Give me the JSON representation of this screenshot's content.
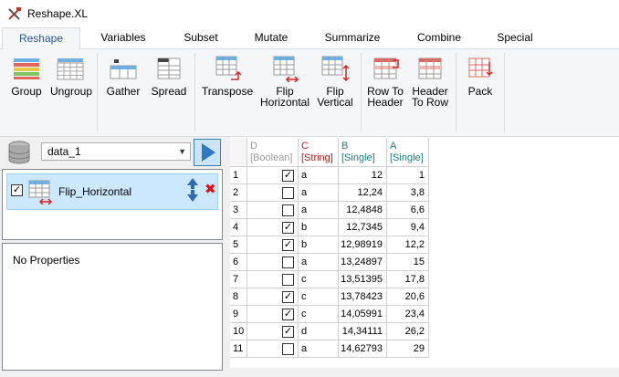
{
  "window": {
    "title": "Reshape.XL"
  },
  "tabs": [
    {
      "label": "Reshape",
      "active": true
    },
    {
      "label": "Variables"
    },
    {
      "label": "Subset"
    },
    {
      "label": "Mutate"
    },
    {
      "label": "Summarize"
    },
    {
      "label": "Combine"
    },
    {
      "label": "Special"
    }
  ],
  "ribbon": {
    "group": {
      "label": "Group"
    },
    "ungroup": {
      "label": "Ungroup"
    },
    "gather": {
      "label": "Gather"
    },
    "spread": {
      "label": "Spread"
    },
    "transpose": {
      "label": "Transpose"
    },
    "flip_h": {
      "line1": "Flip",
      "line2": "Horizontal"
    },
    "flip_v": {
      "line1": "Flip",
      "line2": "Vertical"
    },
    "row_to_header": {
      "line1": "Row To",
      "line2": "Header"
    },
    "header_to_row": {
      "line1": "Header",
      "line2": "To Row"
    },
    "pack": {
      "label": "Pack"
    }
  },
  "dataset": {
    "selected": "data_1"
  },
  "operations": [
    {
      "label": "Flip_Horizontal",
      "checked": true
    }
  ],
  "properties": {
    "text": "No Properties"
  },
  "grid": {
    "columns": [
      {
        "name": "D",
        "type": "[Boolean]",
        "kind": "bool"
      },
      {
        "name": "C",
        "type": "[String]",
        "kind": "str"
      },
      {
        "name": "B",
        "type": "[Single]",
        "kind": "num"
      },
      {
        "name": "A",
        "type": "[Single]",
        "kind": "num"
      }
    ],
    "rows": [
      {
        "n": "1",
        "d": true,
        "c": "a",
        "b": "12",
        "a": "1"
      },
      {
        "n": "2",
        "d": false,
        "c": "a",
        "b": "12,24",
        "a": "3,8"
      },
      {
        "n": "3",
        "d": false,
        "c": "a",
        "b": "12,4848",
        "a": "6,6"
      },
      {
        "n": "4",
        "d": true,
        "c": "b",
        "b": "12,7345",
        "a": "9,4"
      },
      {
        "n": "5",
        "d": true,
        "c": "b",
        "b": "12,98919",
        "a": "12,2"
      },
      {
        "n": "6",
        "d": false,
        "c": "a",
        "b": "13,24897",
        "a": "15"
      },
      {
        "n": "7",
        "d": false,
        "c": "c",
        "b": "13,51395",
        "a": "17,8"
      },
      {
        "n": "8",
        "d": true,
        "c": "c",
        "b": "13,78423",
        "a": "20,6"
      },
      {
        "n": "9",
        "d": true,
        "c": "c",
        "b": "14,05991",
        "a": "23,4"
      },
      {
        "n": "10",
        "d": true,
        "c": "d",
        "b": "14,34111",
        "a": "26,2"
      },
      {
        "n": "11",
        "d": false,
        "c": "a",
        "b": "14,62793",
        "a": "29"
      }
    ]
  }
}
